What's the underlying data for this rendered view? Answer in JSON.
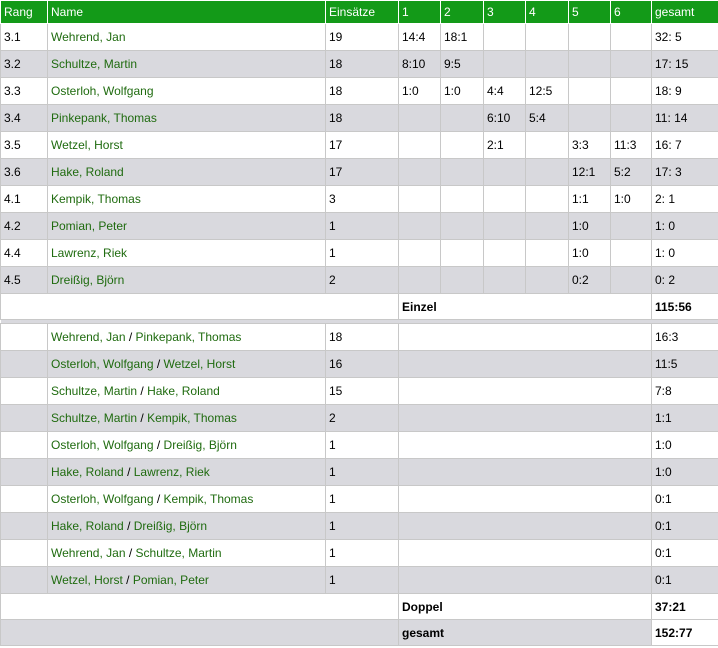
{
  "headers": {
    "rang": "Rang",
    "name": "Name",
    "einsaetze": "Einsätze",
    "s1": "1",
    "s2": "2",
    "s3": "3",
    "s4": "4",
    "s5": "5",
    "s6": "6",
    "gesamt": "gesamt"
  },
  "singles": [
    {
      "rang": "3.1",
      "name": "Wehrend, Jan",
      "einsaetze": "19",
      "s1": "14:4",
      "s2": "18:1",
      "s3": "",
      "s4": "",
      "s5": "",
      "s6": "",
      "gesamt": "32: 5"
    },
    {
      "rang": "3.2",
      "name": "Schultze, Martin",
      "einsaetze": "18",
      "s1": "8:10",
      "s2": "9:5",
      "s3": "",
      "s4": "",
      "s5": "",
      "s6": "",
      "gesamt": "17: 15"
    },
    {
      "rang": "3.3",
      "name": "Osterloh, Wolfgang",
      "einsaetze": "18",
      "s1": "1:0",
      "s2": "1:0",
      "s3": "4:4",
      "s4": "12:5",
      "s5": "",
      "s6": "",
      "gesamt": "18: 9"
    },
    {
      "rang": "3.4",
      "name": "Pinkepank, Thomas",
      "einsaetze": "18",
      "s1": "",
      "s2": "",
      "s3": "6:10",
      "s4": "5:4",
      "s5": "",
      "s6": "",
      "gesamt": "11: 14"
    },
    {
      "rang": "3.5",
      "name": "Wetzel, Horst",
      "einsaetze": "17",
      "s1": "",
      "s2": "",
      "s3": "2:1",
      "s4": "",
      "s5": "3:3",
      "s6": "11:3",
      "gesamt": "16: 7"
    },
    {
      "rang": "3.6",
      "name": "Hake, Roland",
      "einsaetze": "17",
      "s1": "",
      "s2": "",
      "s3": "",
      "s4": "",
      "s5": "12:1",
      "s6": "5:2",
      "gesamt": "17: 3"
    },
    {
      "rang": "4.1",
      "name": "Kempik, Thomas",
      "einsaetze": "3",
      "s1": "",
      "s2": "",
      "s3": "",
      "s4": "",
      "s5": "1:1",
      "s6": "1:0",
      "gesamt": "2: 1"
    },
    {
      "rang": "4.2",
      "name": "Pomian, Peter",
      "einsaetze": "1",
      "s1": "",
      "s2": "",
      "s3": "",
      "s4": "",
      "s5": "1:0",
      "s6": "",
      "gesamt": "1: 0"
    },
    {
      "rang": "4.4",
      "name": "Lawrenz, Riek",
      "einsaetze": "1",
      "s1": "",
      "s2": "",
      "s3": "",
      "s4": "",
      "s5": "1:0",
      "s6": "",
      "gesamt": "1: 0"
    },
    {
      "rang": "4.5",
      "name": "Dreißig, Björn",
      "einsaetze": "2",
      "s1": "",
      "s2": "",
      "s3": "",
      "s4": "",
      "s5": "0:2",
      "s6": "",
      "gesamt": "0: 2"
    }
  ],
  "einzel": {
    "label": "Einzel",
    "score": "115:56"
  },
  "doubles": [
    {
      "p1": "Wehrend, Jan",
      "p2": "Pinkepank, Thomas",
      "einsaetze": "18",
      "gesamt": "16:3"
    },
    {
      "p1": "Osterloh, Wolfgang",
      "p2": "Wetzel, Horst",
      "einsaetze": "16",
      "gesamt": "11:5"
    },
    {
      "p1": "Schultze, Martin",
      "p2": "Hake, Roland",
      "einsaetze": "15",
      "gesamt": "7:8"
    },
    {
      "p1": "Schultze, Martin",
      "p2": "Kempik, Thomas",
      "einsaetze": "2",
      "gesamt": "1:1"
    },
    {
      "p1": "Osterloh, Wolfgang",
      "p2": "Dreißig, Björn",
      "einsaetze": "1",
      "gesamt": "1:0"
    },
    {
      "p1": "Hake, Roland",
      "p2": "Lawrenz, Riek",
      "einsaetze": "1",
      "gesamt": "1:0"
    },
    {
      "p1": "Osterloh, Wolfgang",
      "p2": "Kempik, Thomas",
      "einsaetze": "1",
      "gesamt": "0:1"
    },
    {
      "p1": "Hake, Roland",
      "p2": "Dreißig, Björn",
      "einsaetze": "1",
      "gesamt": "0:1"
    },
    {
      "p1": "Wehrend, Jan",
      "p2": "Schultze, Martin",
      "einsaetze": "1",
      "gesamt": "0:1"
    },
    {
      "p1": "Wetzel, Horst",
      "p2": "Pomian, Peter",
      "einsaetze": "1",
      "gesamt": "0:1"
    }
  ],
  "pair_separator": "/",
  "doppel": {
    "label": "Doppel",
    "score": "37:21"
  },
  "total": {
    "label": "gesamt",
    "score": "152:77"
  },
  "colors": {
    "header_bg": "#139a18",
    "row_alt": "#d9d9de",
    "link": "#1f6b0f"
  }
}
